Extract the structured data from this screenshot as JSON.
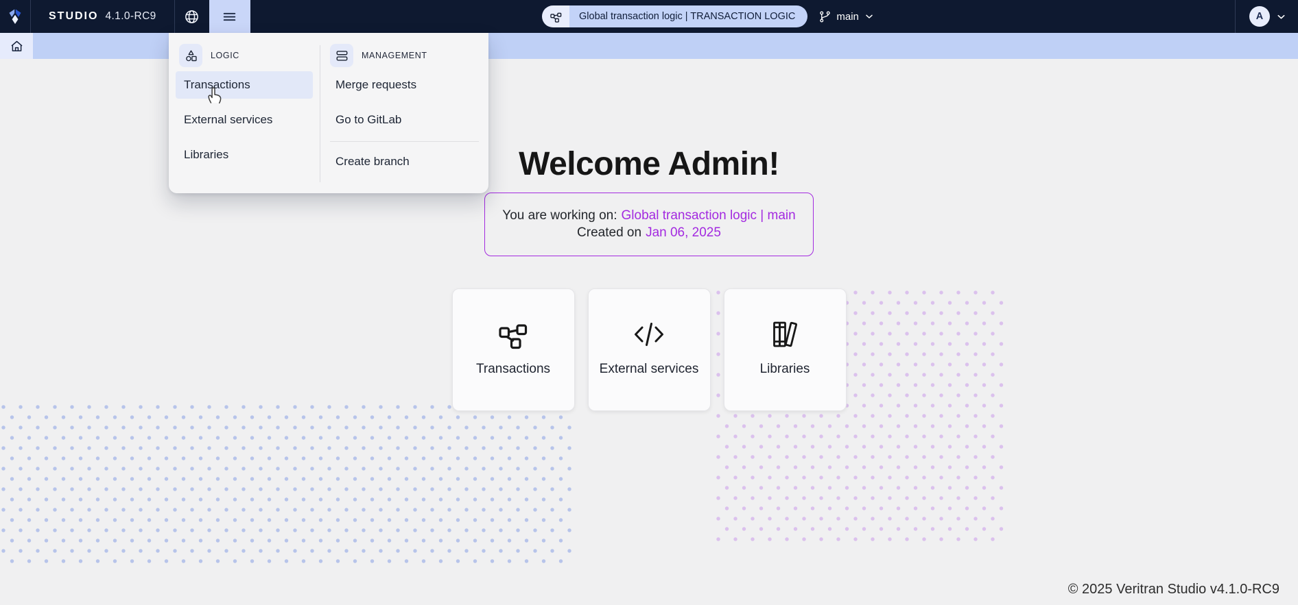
{
  "navbar": {
    "brand": "STUDIO",
    "version": "4.1.0-RC9",
    "project_pill": "Global transaction logic | TRANSACTION LOGIC",
    "branch": "main",
    "avatar_initial": "A"
  },
  "menu": {
    "logic": {
      "title": "LOGIC",
      "icon": "shapes-icon",
      "items": [
        "Transactions",
        "External services",
        "Libraries"
      ],
      "active_item": "Transactions"
    },
    "management": {
      "title": "MANAGEMENT",
      "icon": "stack-icon",
      "items": [
        "Merge requests",
        "Go to GitLab",
        "Create branch"
      ]
    }
  },
  "main": {
    "welcome": "Welcome Admin!",
    "working_on_prefix": "You are working on:",
    "working_on_value": "Global transaction logic | main",
    "created_prefix": "Created on",
    "created_value": "Jan 06, 2025",
    "cards": [
      {
        "label": "Transactions",
        "icon": "hierarchy-icon"
      },
      {
        "label": "External services",
        "icon": "code-icon"
      },
      {
        "label": "Libraries",
        "icon": "books-icon"
      }
    ]
  },
  "footer": {
    "copyright": "© 2025 Veritran Studio v4.1.0-RC9"
  },
  "colors": {
    "navbar_bg": "#0e1930",
    "toolbar_blue": "#bfd0f6",
    "pill_blue": "#c3d3f8",
    "menu_highlight": "#e2e8f8",
    "accent_purple": "#a32ae0",
    "page_bg": "#f0f0f1",
    "dots_blue": "#b7c4ea",
    "dots_purple": "#dbc1ed"
  }
}
